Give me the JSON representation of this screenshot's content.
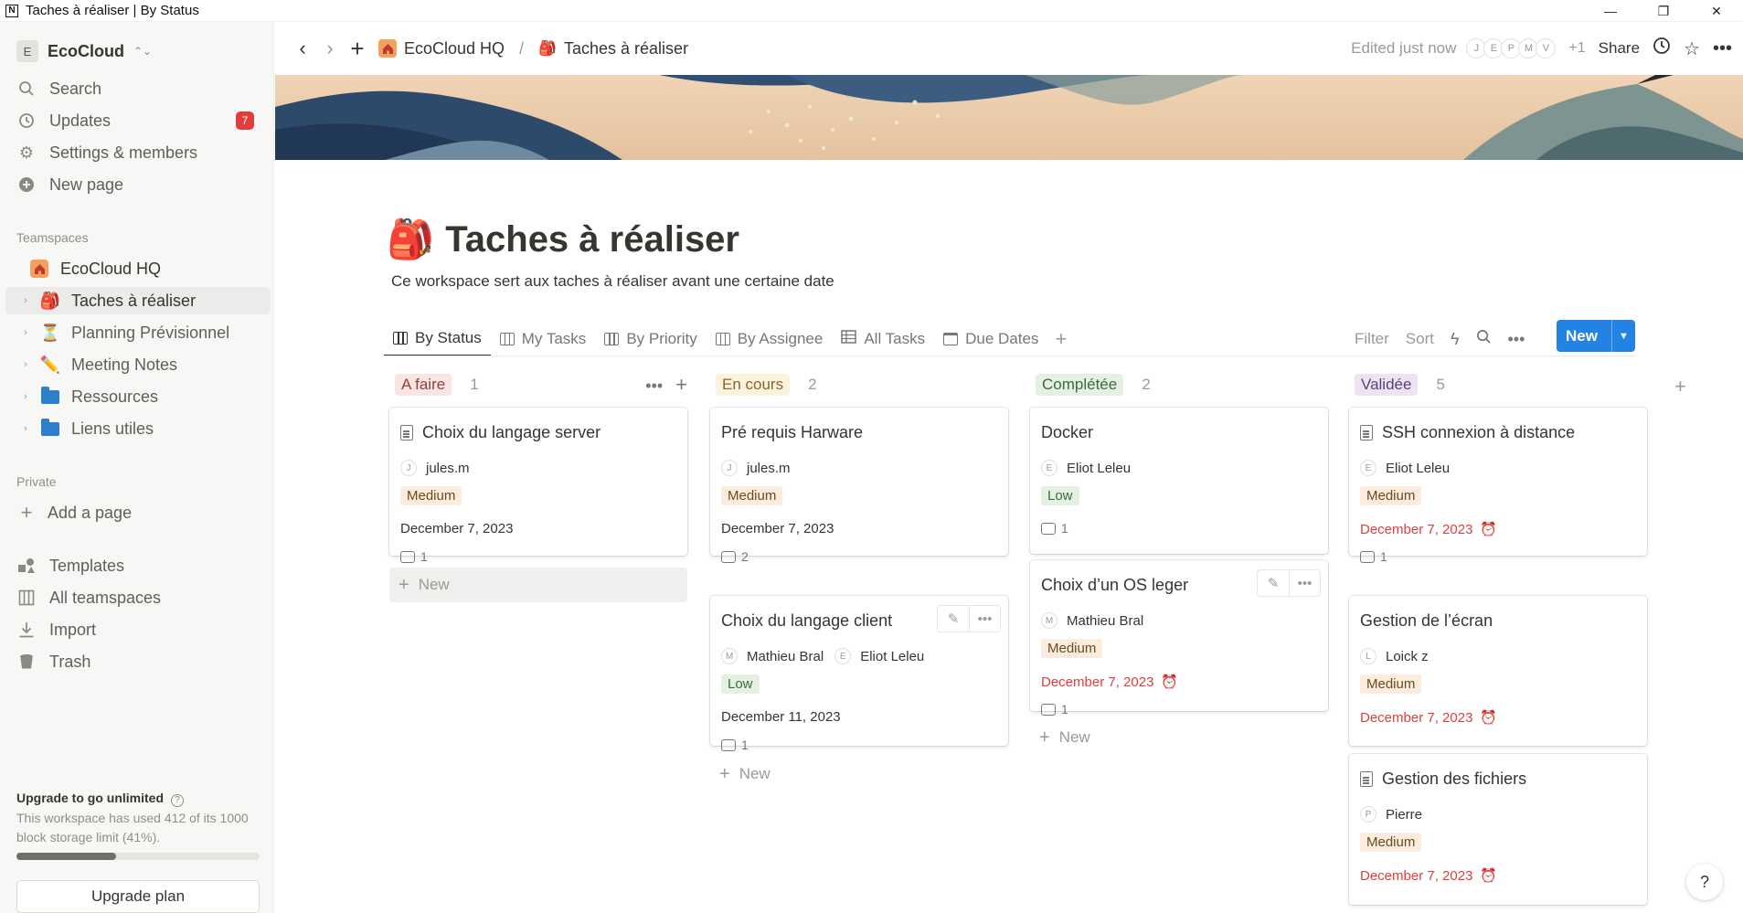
{
  "window": {
    "title": "Taches à réaliser | By Status",
    "min": "—",
    "restore": "❐",
    "close": "✕"
  },
  "sidebar": {
    "workspace": {
      "initial": "E",
      "name": "EcoCloud"
    },
    "top_items": [
      {
        "label": "Search",
        "icon": "search-icon"
      },
      {
        "label": "Updates",
        "icon": "clock-icon",
        "badge": "7"
      },
      {
        "label": "Settings & members",
        "icon": "gear-icon"
      },
      {
        "label": "New page",
        "icon": "plus-circle-icon"
      }
    ],
    "teamspaces_label": "Teamspaces",
    "teamspace": "EcoCloud HQ",
    "pages": [
      {
        "label": "Taches à réaliser",
        "emoji": "🎒",
        "active": true
      },
      {
        "label": "Planning Prévisionnel",
        "emoji": "⏳"
      },
      {
        "label": "Meeting Notes",
        "emoji": "✏️"
      },
      {
        "label": "Ressources",
        "icon": "folder-icon"
      },
      {
        "label": "Liens utiles",
        "icon": "folder-icon"
      }
    ],
    "private_label": "Private",
    "add_page": "Add a page",
    "bottom_items": [
      {
        "label": "Templates",
        "icon": "templates-icon"
      },
      {
        "label": "All teamspaces",
        "icon": "teamspaces-icon"
      },
      {
        "label": "Import",
        "icon": "download-icon"
      },
      {
        "label": "Trash",
        "icon": "trash-icon"
      }
    ],
    "upgrade": {
      "title": "Upgrade to go unlimited",
      "desc": "This workspace has used 412 of its 1000 block storage limit (41%).",
      "progress": 0.41,
      "button": "Upgrade plan"
    }
  },
  "topbar": {
    "breadcrumb": [
      "EcoCloud HQ",
      "Taches à réaliser"
    ],
    "separator": "/",
    "edited": "Edited just now",
    "avatars": [
      "J",
      "E",
      "P",
      "M",
      "V"
    ],
    "more_count": "+1",
    "share": "Share"
  },
  "page": {
    "emoji": "🎒",
    "title": "Taches à réaliser",
    "description": "Ce workspace sert aux taches à réaliser avant une certaine date"
  },
  "views": {
    "tabs": [
      {
        "label": "By Status",
        "icon": "board-icon",
        "active": true
      },
      {
        "label": "My Tasks",
        "icon": "board-icon"
      },
      {
        "label": "By Priority",
        "icon": "board-icon"
      },
      {
        "label": "By Assignee",
        "icon": "board-icon"
      },
      {
        "label": "All Tasks",
        "icon": "table-icon"
      },
      {
        "label": "Due Dates",
        "icon": "calendar-icon"
      }
    ],
    "filter": "Filter",
    "sort": "Sort",
    "new": "New"
  },
  "colors": {
    "accent": "#2383e2",
    "late": "#e03e3e"
  },
  "board": {
    "new_label": "New",
    "columns": [
      {
        "name": "A faire",
        "count": "1",
        "bg": "#fbe4e4",
        "fg": "#93403a",
        "cards": [
          {
            "title": "Choix du langage server",
            "doc": true,
            "people": [
              {
                "i": "J",
                "name": "jules.m"
              }
            ],
            "priority": "Medium",
            "date": "December 7, 2023",
            "late": false,
            "comments": "1"
          }
        ]
      },
      {
        "name": "En cours",
        "count": "2",
        "bg": "#fbf3db",
        "fg": "#89632a",
        "cards": [
          {
            "title": "Pré requis Harware",
            "doc": false,
            "people": [
              {
                "i": "J",
                "name": "jules.m"
              }
            ],
            "priority": "Medium",
            "date": "December 7, 2023",
            "late": false,
            "comments": "2"
          },
          {
            "title": "Choix du langage client",
            "doc": false,
            "hover": true,
            "people": [
              {
                "i": "M",
                "name": "Mathieu Bral"
              },
              {
                "i": "E",
                "name": "Eliot Leleu"
              }
            ],
            "priority": "Low",
            "date": "December 11, 2023",
            "late": false,
            "comments": "1"
          }
        ]
      },
      {
        "name": "Complétée",
        "count": "2",
        "bg": "#e4f0e2",
        "fg": "#3d6b3f",
        "cards": [
          {
            "title": "Docker",
            "doc": false,
            "people": [
              {
                "i": "E",
                "name": "Eliot Leleu"
              }
            ],
            "priority": "Low",
            "date": "",
            "late": false,
            "comments": "1"
          },
          {
            "title": "Choix d’un OS leger",
            "doc": false,
            "hover": true,
            "people": [
              {
                "i": "M",
                "name": "Mathieu Bral"
              }
            ],
            "priority": "Medium",
            "date": "December 7, 2023",
            "late": true,
            "comments": "1"
          }
        ]
      },
      {
        "name": "Validée",
        "count": "5",
        "bg": "#ece4f3",
        "fg": "#5e3f7c",
        "cards": [
          {
            "title": "SSH connexion à distance",
            "doc": true,
            "people": [
              {
                "i": "E",
                "name": "Eliot Leleu"
              }
            ],
            "priority": "Medium",
            "date": "December 7, 2023",
            "late": true,
            "comments": "1"
          },
          {
            "title": "Gestion de l’écran",
            "doc": false,
            "people": [
              {
                "i": "L",
                "name": "Loick z"
              }
            ],
            "priority": "Medium",
            "date": "December 7, 2023",
            "late": true,
            "comments": ""
          },
          {
            "title": "Gestion des fichiers",
            "doc": true,
            "people": [
              {
                "i": "P",
                "name": "Pierre"
              }
            ],
            "priority": "Medium",
            "date": "December 7, 2023",
            "late": true,
            "comments": ""
          }
        ]
      }
    ]
  },
  "help": "?"
}
